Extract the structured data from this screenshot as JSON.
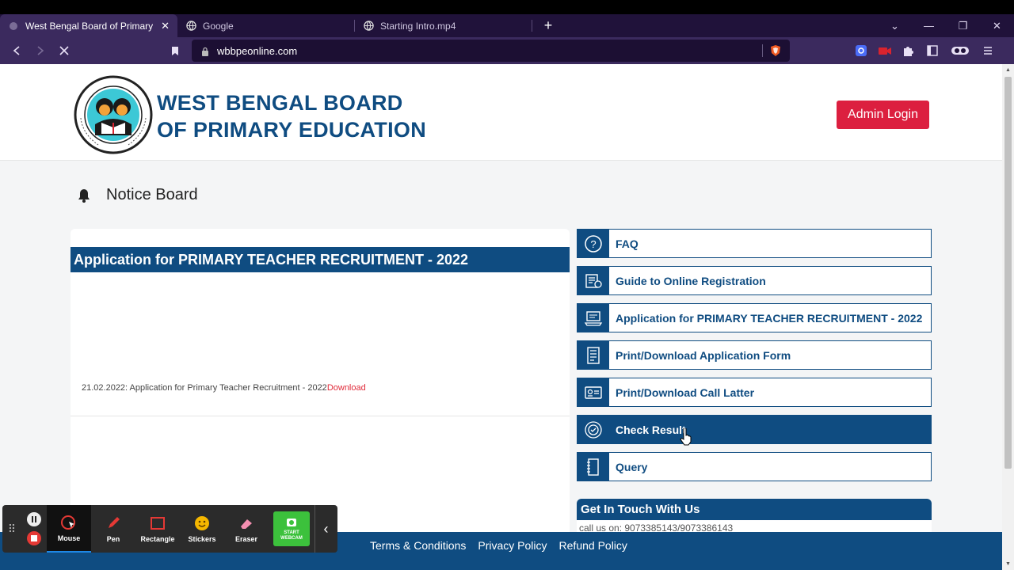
{
  "browser": {
    "tabs": [
      {
        "title": "West Bengal Board of Primary Edu",
        "active": true
      },
      {
        "title": "Google",
        "active": false
      },
      {
        "title": "Starting Intro.mp4",
        "active": false
      }
    ],
    "new_tab_symbol": "+",
    "url": "wbbpeonline.com"
  },
  "site": {
    "brand_line1": "WEST BENGAL BOARD",
    "brand_line2": "OF PRIMARY EDUCATION",
    "admin_login": "Admin Login",
    "notice_board": "Notice Board",
    "card_title": "Application for PRIMARY TEACHER RECRUITMENT - 2022",
    "notice_text": "21.02.2022: Application for Primary Teacher Recruitment - 2022",
    "notice_link": "Download",
    "menu": [
      {
        "label": "FAQ",
        "icon": "question-icon"
      },
      {
        "label": "Guide to Online Registration",
        "icon": "guide-icon"
      },
      {
        "label": "Application for PRIMARY TEACHER RECRUITMENT - 2022",
        "icon": "laptop-icon"
      },
      {
        "label": "Print/Download Application Form",
        "icon": "form-icon"
      },
      {
        "label": "Print/Download Call Latter",
        "icon": "id-card-icon"
      },
      {
        "label": "Check Result",
        "icon": "result-icon",
        "active": true
      },
      {
        "label": "Query",
        "icon": "notebook-icon"
      }
    ],
    "contact_title": "Get In Touch With Us",
    "contact_line": "call us on: 9073385143/9073386143",
    "footer_links": [
      "Terms & Conditions",
      "Privacy Policy",
      "Refund Policy"
    ]
  },
  "recorder": {
    "tools": [
      {
        "label": "Mouse",
        "active": true
      },
      {
        "label": "Pen"
      },
      {
        "label": "Rectangle"
      },
      {
        "label": "Stickers"
      },
      {
        "label": "Eraser"
      }
    ],
    "webcam_label": "START WEBCAM"
  },
  "colors": {
    "primary": "#0f4c81",
    "admin_red": "#dc1f3f",
    "browser_dark": "#20123a",
    "browser_mid": "#3b2a5e"
  }
}
